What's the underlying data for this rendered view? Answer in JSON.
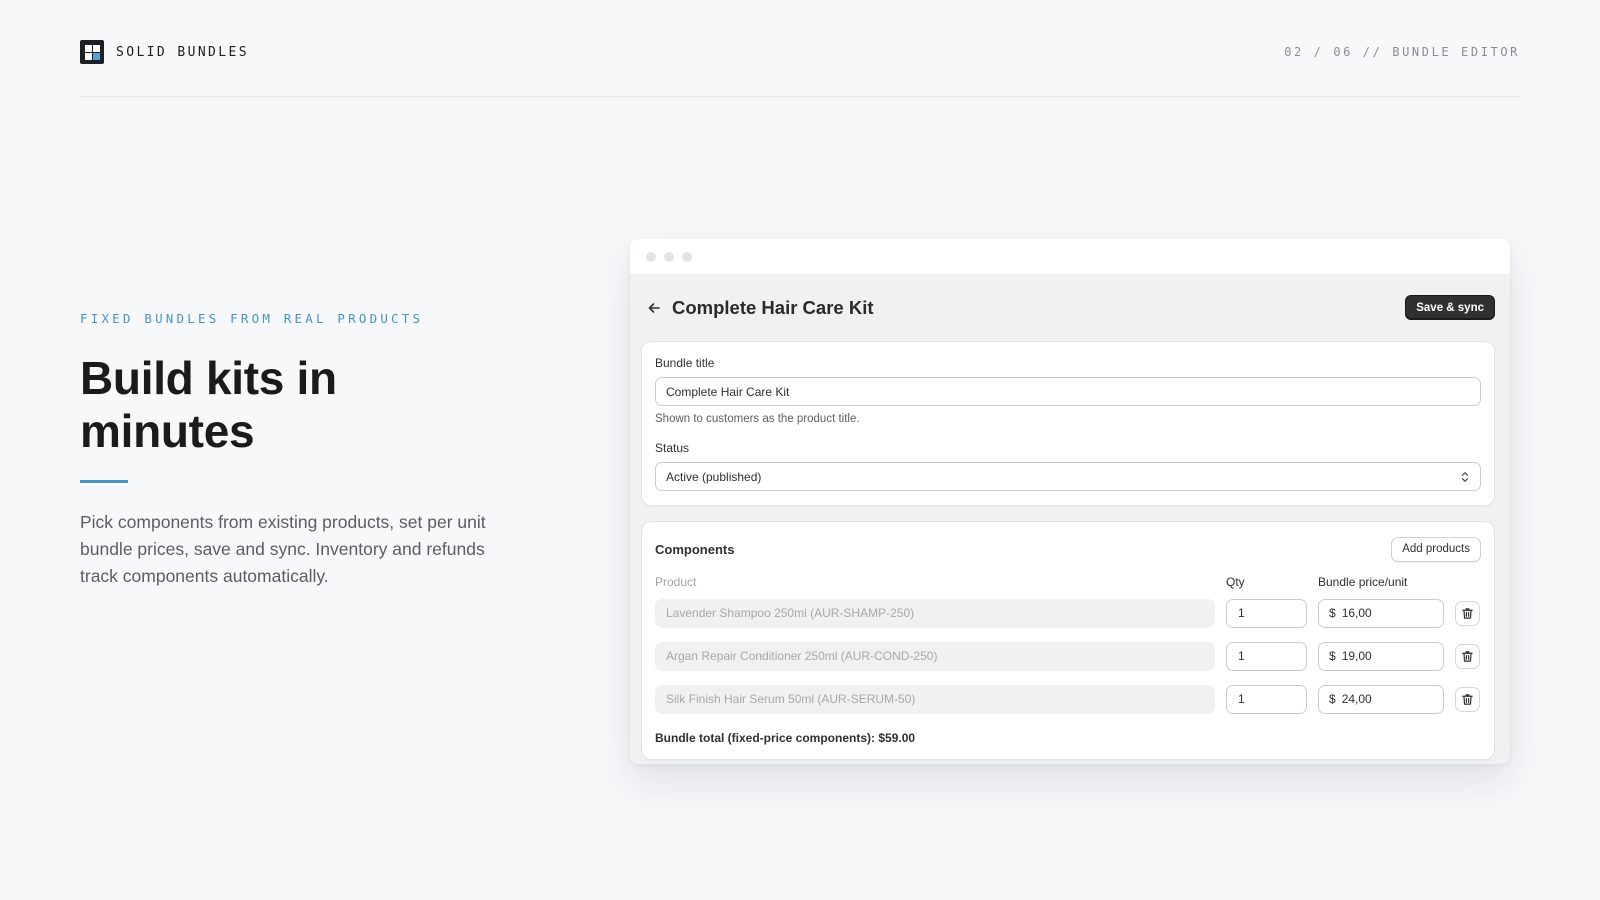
{
  "header": {
    "brand_name": "SOLID BUNDLES",
    "breadcrumb": "02 / 06 // BUNDLE EDITOR"
  },
  "hero": {
    "eyebrow": "FIXED BUNDLES FROM REAL PRODUCTS",
    "headline_line1": "Build kits in",
    "headline_line2": "minutes",
    "lead": "Pick components from existing products, set per unit bundle prices, save and sync. Inventory and refunds track components automatically."
  },
  "editor": {
    "title": "Complete Hair Care Kit",
    "save_label": "Save & sync",
    "bundle_title_label": "Bundle title",
    "bundle_title_value": "Complete Hair Care Kit",
    "bundle_title_help": "Shown to customers as the product title.",
    "status_label": "Status",
    "status_value": "Active (published)",
    "components": {
      "title": "Components",
      "add_label": "Add products",
      "col_product": "Product",
      "col_qty": "Qty",
      "col_price": "Bundle price/unit",
      "currency": "$",
      "rows": [
        {
          "product": "Lavender Shampoo 250ml (AUR-SHAMP-250)",
          "qty": "1",
          "price": "16,00"
        },
        {
          "product": "Argan Repair Conditioner 250ml (AUR-COND-250)",
          "qty": "1",
          "price": "19,00"
        },
        {
          "product": "Silk Finish Hair Serum 50ml (AUR-SERUM-50)",
          "qty": "1",
          "price": "24,00"
        }
      ],
      "total_text": "Bundle total (fixed-price components): $59.00"
    }
  },
  "colors": {
    "accent": "#4a93c6",
    "primary_button": "#303030",
    "background": "#f7f8fa"
  },
  "icons": {
    "back": "arrow-left-icon",
    "select": "chevron-up-down-icon",
    "delete": "trash-icon",
    "logo": "grid-logo-icon"
  }
}
